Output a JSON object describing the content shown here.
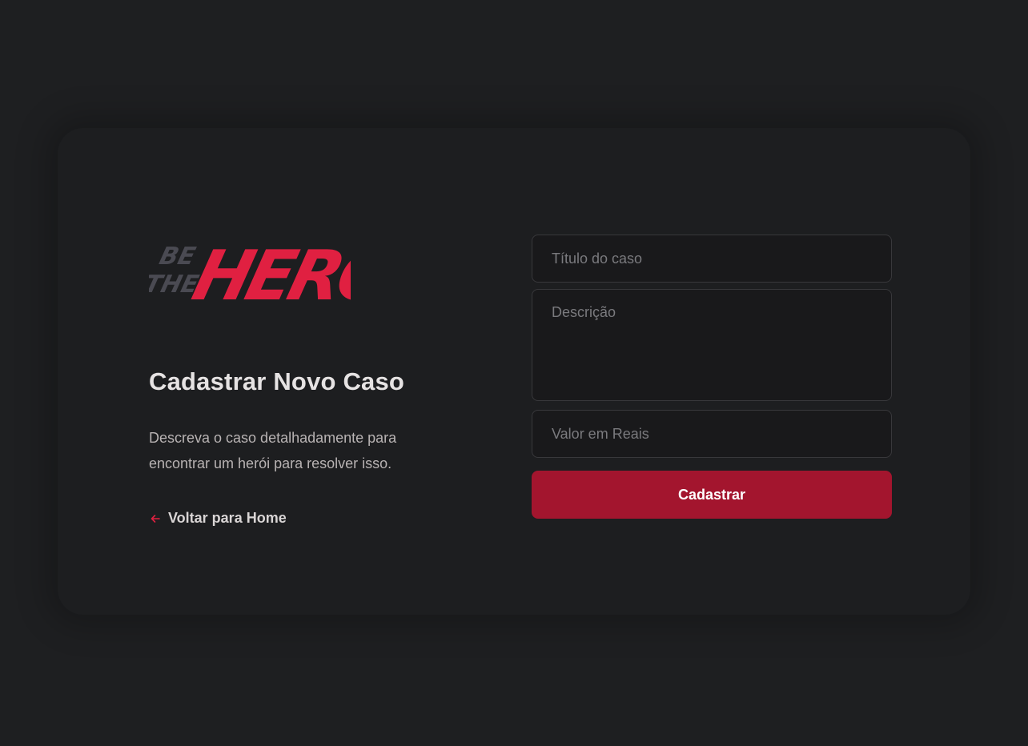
{
  "brand": {
    "logo_be": "BE",
    "logo_the": "THE",
    "logo_hero": "HERO",
    "accent_color": "#e02041",
    "muted_color": "#4a4a52"
  },
  "intro": {
    "title": "Cadastrar Novo Caso",
    "description": "Descreva o caso detalhadamente para encontrar um herói para resolver isso.",
    "back_label": "Voltar para Home",
    "back_icon": "arrow-left-icon"
  },
  "form": {
    "title_placeholder": "Título do caso",
    "title_value": "",
    "description_placeholder": "Descrição",
    "description_value": "",
    "value_placeholder": "Valor em Reais",
    "value_value": "",
    "submit_label": "Cadastrar",
    "submit_color": "#a3152e"
  }
}
